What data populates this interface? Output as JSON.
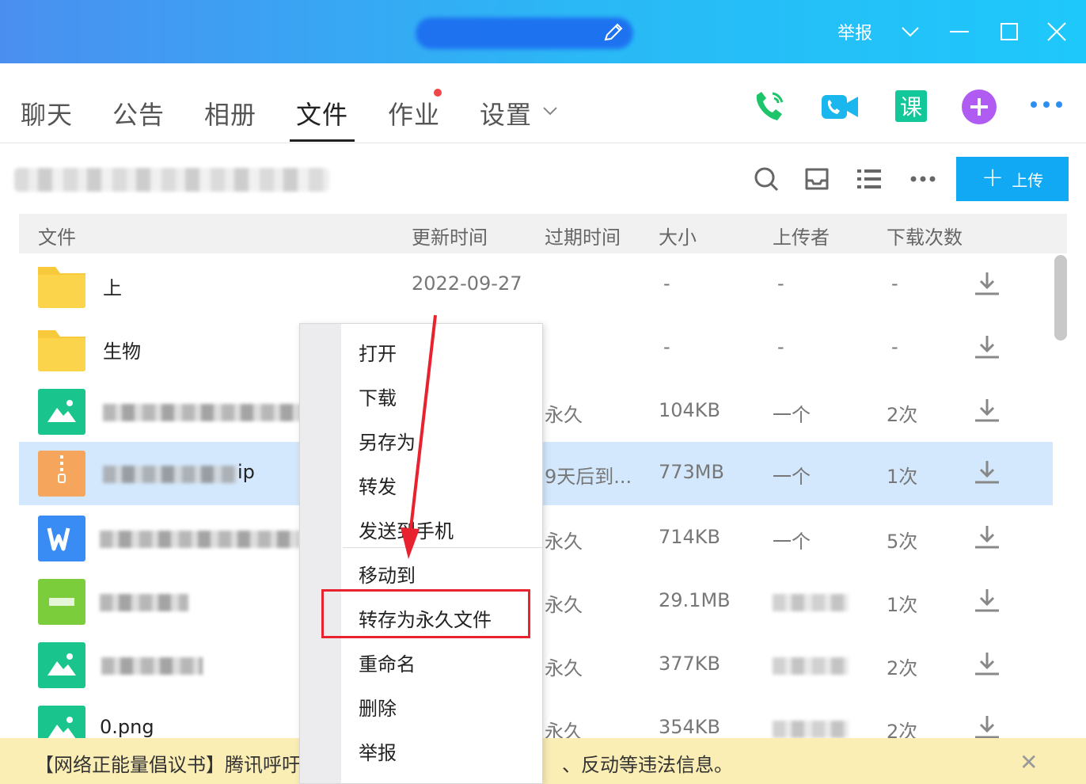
{
  "titlebar": {
    "report_label": "举报",
    "icons": [
      "edit-icon",
      "chevron-down-icon",
      "minimize-icon",
      "maximize-icon",
      "close-icon"
    ]
  },
  "tabs": [
    {
      "label": "聊天"
    },
    {
      "label": "公告"
    },
    {
      "label": "相册"
    },
    {
      "label": "文件",
      "active": true
    },
    {
      "label": "作业",
      "badge": "dot"
    },
    {
      "label": "设置"
    }
  ],
  "actions": [
    "phone-call-icon",
    "video-call-icon",
    "lesson-icon",
    "add-app-icon",
    "more-icon"
  ],
  "toolbar": {
    "upload_label": "上传",
    "icons": [
      "search-icon",
      "inbox-icon",
      "list-view-icon",
      "more-icon"
    ]
  },
  "table": {
    "headers": {
      "name": "文件",
      "updated": "更新时间",
      "expiry": "过期时间",
      "size": "大小",
      "uploader": "上传者",
      "downloads": "下载次数"
    },
    "rows": [
      {
        "icon": "folder-icon",
        "name": "上",
        "updated": "2022-09-27",
        "expiry": "",
        "size": "-",
        "uploader": "-",
        "downloads": "-"
      },
      {
        "icon": "folder-icon",
        "name": "生物",
        "updated": "",
        "expiry": "",
        "size": "-",
        "uploader": "-",
        "downloads": "-"
      },
      {
        "icon": "image-file-icon",
        "name": "",
        "expiry": "永久",
        "size": "104KB",
        "uploader": "一个",
        "downloads": "2次"
      },
      {
        "icon": "zip-file-icon",
        "name": "ip",
        "expiry": "9天后到...",
        "size": "773MB",
        "uploader": "一个",
        "downloads": "1次",
        "selected": true
      },
      {
        "icon": "word-file-icon",
        "name": "",
        "expiry": "永久",
        "size": "714KB",
        "uploader": "一个",
        "downloads": "5次"
      },
      {
        "icon": "green-file-icon",
        "name": "",
        "expiry": "永久",
        "size": "29.1MB",
        "uploader": "",
        "downloads": "1次"
      },
      {
        "icon": "image-file-icon",
        "name": "",
        "expiry": "永久",
        "size": "377KB",
        "uploader": "",
        "downloads": "2次"
      },
      {
        "icon": "image-file-icon",
        "name": "0.png",
        "expiry": "永久",
        "size": "354KB",
        "uploader": "",
        "downloads": "2次"
      }
    ]
  },
  "context_menu": {
    "items": [
      "打开",
      "下载",
      "另存为",
      "转发",
      "发送到手机",
      "移动到",
      "转存为永久文件",
      "重命名",
      "删除",
      "举报"
    ],
    "highlighted": "转存为永久文件"
  },
  "notice": {
    "text_start": "【网络正能量倡议书】腾讯呼吁",
    "text_end": "、反动等违法信息。"
  },
  "colors": {
    "title_gradient_start": "#4a8ff0",
    "title_gradient_end": "#1ec8fb",
    "upload_button": "#12a9f4",
    "selected_row": "#d4e8fd",
    "highlight_border": "#e8232f",
    "notice_bg": "#fbeeb5"
  }
}
